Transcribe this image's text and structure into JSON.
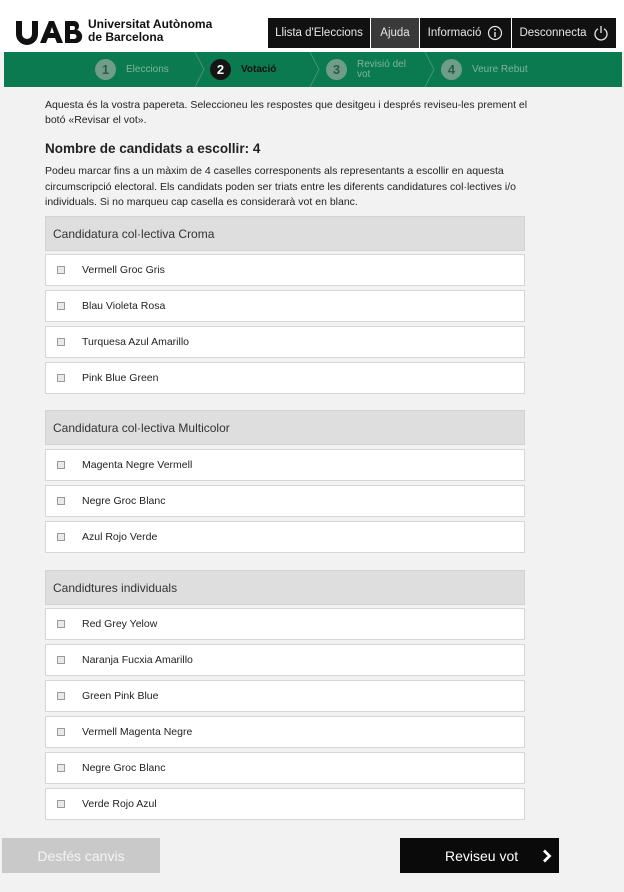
{
  "brand": {
    "name_line1": "Universitat Autònoma",
    "name_line2": "de Barcelona"
  },
  "nav": {
    "elections_list": "Llista d'Eleccions",
    "help": "Ajuda",
    "information": "Informació",
    "logout": "Desconnecta"
  },
  "steps": [
    {
      "number": "1",
      "label": "Eleccions"
    },
    {
      "number": "2",
      "label": "Votació"
    },
    {
      "number": "3",
      "label_line1": "Revisió del",
      "label_line2": "vot"
    },
    {
      "number": "4",
      "label": "Veure Rebut"
    }
  ],
  "intro": "Aquesta és la vostra papereta. Seleccioneu les respostes que desitgeu i després reviseu-les prement el botó «Revisar el vot».",
  "candidates_title": "Nombre de candidats a escollir: 4",
  "instructions": "Podeu marcar fins a un màxim de 4 caselles corresponents als representants a escollir en aquesta circumscripció electoral. Els candidats poden ser triats entre les diferents candidatures col·lectives i/o individuals. Si no marqueu cap casella es considerarà vot en blanc.",
  "groups": [
    {
      "title": "Candidatura col·lectiva Croma",
      "options": [
        "Vermell Groc Gris",
        "Blau Violeta Rosa",
        "Turquesa Azul Amarillo",
        "Pink Blue Green"
      ]
    },
    {
      "title": "Candidatura col·lectiva Multicolor",
      "options": [
        "Magenta Negre Vermell",
        "Negre Groc Blanc",
        "Azul Rojo Verde"
      ]
    },
    {
      "title": "Candidtures individuals",
      "options": [
        "Red Grey Yelow",
        "Naranja Fucxia Amarillo",
        "Green Pink Blue",
        "Vermell Magenta Negre",
        "Negre Groc Blanc",
        "Verde Rojo Azul"
      ]
    }
  ],
  "buttons": {
    "undo": "Desfés canvis",
    "review": "Reviseu vot"
  },
  "colors": {
    "steps_bar": "#0b7a50",
    "nav_background": "#111111",
    "review_button": "#0a0a0a",
    "undo_button_disabled": "#c9c9c9"
  },
  "icons": {
    "information": "info-circle-icon",
    "logout": "power-icon",
    "review": "chevron-right-icon",
    "step_separator": "chevron-right-outline-icon"
  }
}
